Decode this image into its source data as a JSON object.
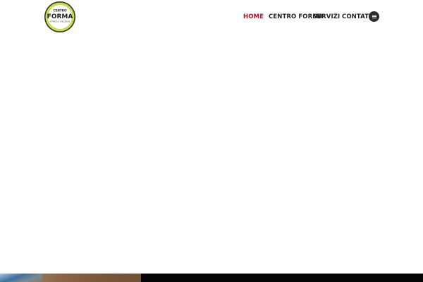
{
  "brand": {
    "logo_top": "CENTRO",
    "logo_main": "FORMA",
    "logo_sub": "FITNESS & WELLNESS",
    "ring_color": "#c6e04a"
  },
  "nav": {
    "items": [
      {
        "label": "HOME",
        "active": true
      },
      {
        "label": "CENTRO FORMA",
        "active": false
      },
      {
        "label": "SERVIZI",
        "active": false
      },
      {
        "label": "CONTATTI",
        "active": false
      }
    ],
    "active_color": "#b5101e",
    "text_color": "#222222",
    "menu_icon": "hamburger-icon"
  }
}
